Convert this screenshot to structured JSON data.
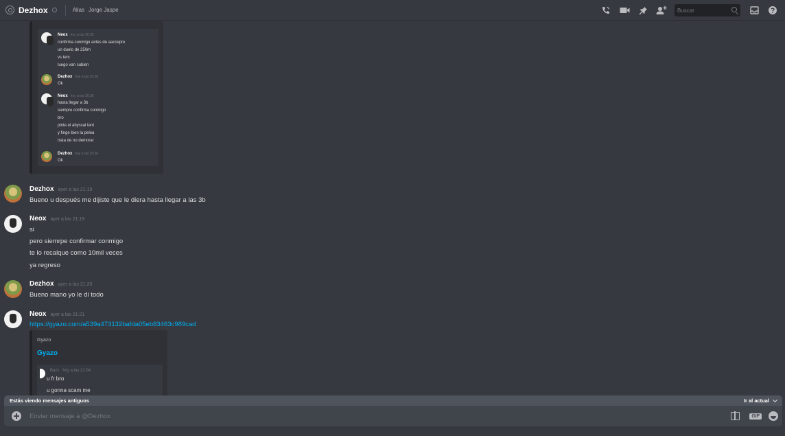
{
  "header": {
    "channel_name": "Dezhox",
    "alias_label": "Alias",
    "alias_value": "Jorge Jaspe",
    "search_placeholder": "Buscar",
    "icons": [
      "call-icon",
      "video-icon",
      "pin-icon",
      "add-friend-icon",
      "inbox-icon",
      "help-icon"
    ]
  },
  "screenshot_embed": {
    "messages": [
      {
        "author": "Neox",
        "time": "hoy a las 20:35",
        "lines": [
          "confirma conmigo antes de aaccepre",
          "un duelo de 250m",
          "vs tem",
          "luego van subien"
        ]
      },
      {
        "author": "Dezhox",
        "time": "hoy a las 20:36",
        "lines": [
          "Ok"
        ]
      },
      {
        "author": "Neox",
        "time": "hoy a las 20:36",
        "lines": [
          "hasta llegar a 3b",
          "siempre confirma conmigo",
          "bro",
          "pinte el abyssal tent",
          "y finge bien la pelea",
          "trata de no demorar"
        ]
      },
      {
        "author": "Dezhox",
        "time": "hoy a las 20:36",
        "lines": [
          "Ok"
        ]
      }
    ]
  },
  "messages": [
    {
      "author": "Dezhox",
      "time": "ayer a las 21:19",
      "lines": [
        "Bueno u después me dijiste que le diera hasta llegar a las 3b"
      ]
    },
    {
      "author": "Neox",
      "time": "ayer a las 21:19",
      "lines": [
        "si",
        "pero siemrpe confirmar conmigo",
        "te lo recalque como 10mil veces",
        "ya regreso"
      ]
    },
    {
      "author": "Dezhox",
      "time": "ayer a las 21:20",
      "lines": [
        "Bueno mano yo le di todo"
      ]
    },
    {
      "author": "Neox",
      "time": "ayer a las 21:21",
      "link": "https://gyazo.com/a539a473132bafda05eb83463c989cad"
    }
  ],
  "link_embed": {
    "provider": "Gyazo",
    "title": "Gyazo",
    "preview": {
      "author": "Bazs",
      "time": "hoy a las 21:04",
      "lines": [
        "u fr bro",
        "u gonna scam me"
      ]
    }
  },
  "old_messages_bar": {
    "text": "Estás viendo mensajes antiguos",
    "jump_label": "Ir al actual"
  },
  "composer": {
    "placeholder": "Enviar mensaje a @Dezhox",
    "gif_label": "GIF"
  }
}
